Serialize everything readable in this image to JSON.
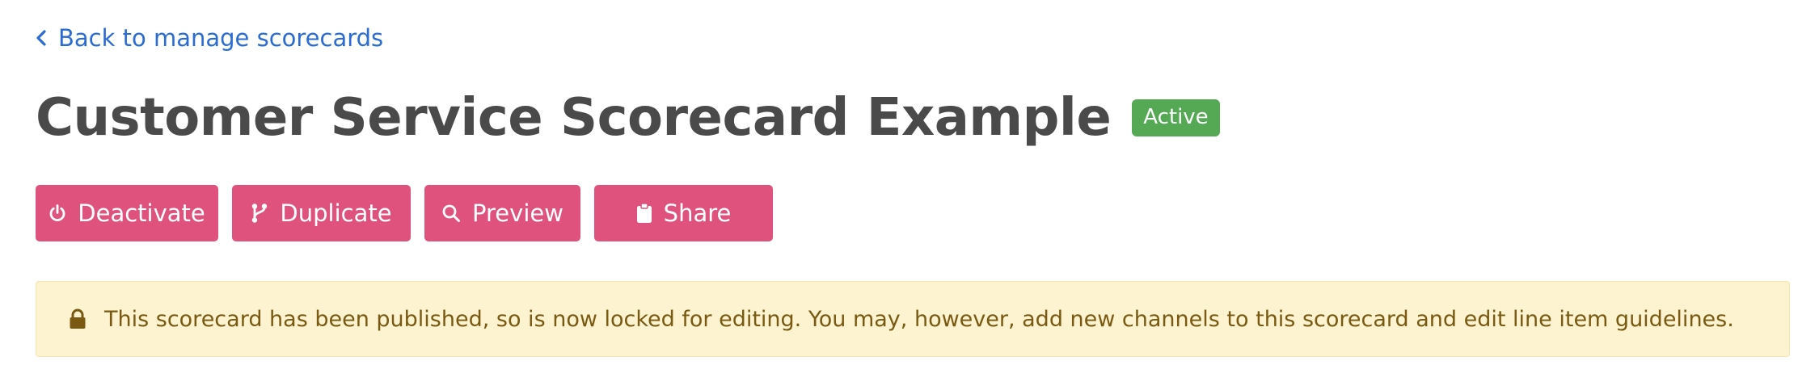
{
  "back_link": {
    "label": "Back to manage scorecards",
    "icon": "chevron-left-icon"
  },
  "header": {
    "title": "Customer Service Scorecard Example",
    "status": "Active",
    "status_color": "#55a854"
  },
  "toolbar": {
    "accent_color": "#df527e",
    "buttons": [
      {
        "label": "Deactivate",
        "icon": "power-icon"
      },
      {
        "label": "Duplicate",
        "icon": "branch-icon"
      },
      {
        "label": "Preview",
        "icon": "search-icon"
      },
      {
        "label": "Share",
        "icon": "clipboard-icon"
      }
    ]
  },
  "notice": {
    "icon": "lock-icon",
    "message": "This scorecard has been published, so is now locked for editing. You may, however, add new channels to this scorecard and edit line item guidelines.",
    "background": "#fdf3d1",
    "text_color": "#7a5a12"
  }
}
